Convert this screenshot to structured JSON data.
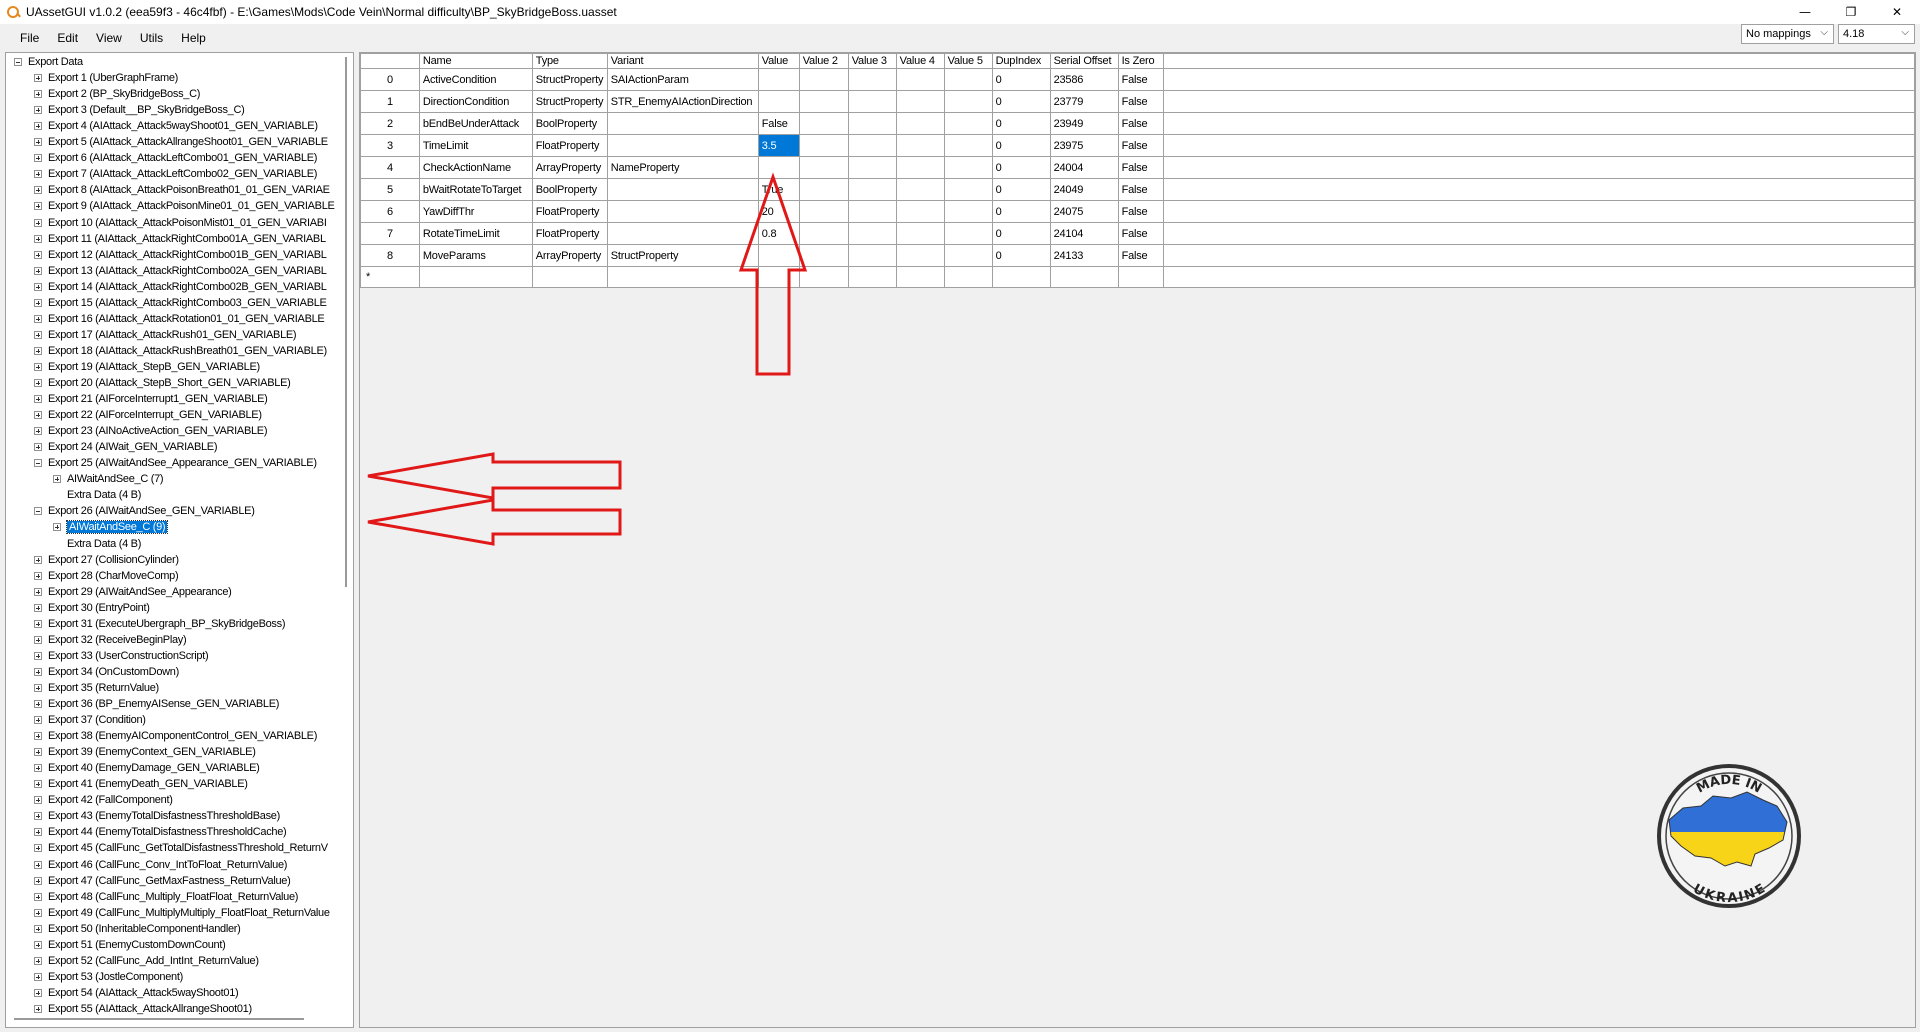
{
  "window": {
    "title": "UAssetGUI v1.0.2 (eea59f3 - 46c4fbf) - E:\\Games\\Mods\\Code Vein\\Normal difficulty\\BP_SkyBridgeBoss.uasset",
    "minimize": "—",
    "maximize": "❐",
    "close": "✕"
  },
  "menu": {
    "file": "File",
    "edit": "Edit",
    "view": "View",
    "utils": "Utils",
    "help": "Help"
  },
  "mappings_dropdown": {
    "value": "No mappings"
  },
  "version_dropdown": {
    "value": "4.18"
  },
  "tree": {
    "root": "Export Data",
    "items": [
      "Export 1 (UberGraphFrame)",
      "Export 2 (BP_SkyBridgeBoss_C)",
      "Export 3 (Default__BP_SkyBridgeBoss_C)",
      "Export 4 (AIAttack_Attack5wayShoot01_GEN_VARIABLE)",
      "Export 5 (AIAttack_AttackAllrangeShoot01_GEN_VARIABLE",
      "Export 6 (AIAttack_AttackLeftCombo01_GEN_VARIABLE)",
      "Export 7 (AIAttack_AttackLeftCombo02_GEN_VARIABLE)",
      "Export 8 (AIAttack_AttackPoisonBreath01_01_GEN_VARIAE",
      "Export 9 (AIAttack_AttackPoisonMine01_01_GEN_VARIABLE",
      "Export 10 (AIAttack_AttackPoisonMist01_01_GEN_VARIABI",
      "Export 11 (AIAttack_AttackRightCombo01A_GEN_VARIABL",
      "Export 12 (AIAttack_AttackRightCombo01B_GEN_VARIABL",
      "Export 13 (AIAttack_AttackRightCombo02A_GEN_VARIABL",
      "Export 14 (AIAttack_AttackRightCombo02B_GEN_VARIABL",
      "Export 15 (AIAttack_AttackRightCombo03_GEN_VARIABLE",
      "Export 16 (AIAttack_AttackRotation01_01_GEN_VARIABLE",
      "Export 17 (AIAttack_AttackRush01_GEN_VARIABLE)",
      "Export 18 (AIAttack_AttackRushBreath01_GEN_VARIABLE)",
      "Export 19 (AIAttack_StepB_GEN_VARIABLE)",
      "Export 20 (AIAttack_StepB_Short_GEN_VARIABLE)",
      "Export 21 (AIForceInterrupt1_GEN_VARIABLE)",
      "Export 22 (AIForceInterrupt_GEN_VARIABLE)",
      "Export 23 (AINoActiveAction_GEN_VARIABLE)",
      "Export 24 (AIWait_GEN_VARIABLE)",
      "Export 25 (AIWaitAndSee_Appearance_GEN_VARIABLE)",
      "AIWaitAndSee_C (7)",
      "Extra Data (4 B)",
      "Export 26 (AIWaitAndSee_GEN_VARIABLE)",
      "AIWaitAndSee_C (9)",
      "Extra Data (4 B)",
      "Export 27 (CollisionCylinder)",
      "Export 28 (CharMoveComp)",
      "Export 29 (AIWaitAndSee_Appearance)",
      "Export 30 (EntryPoint)",
      "Export 31 (ExecuteUbergraph_BP_SkyBridgeBoss)",
      "Export 32 (ReceiveBeginPlay)",
      "Export 33 (UserConstructionScript)",
      "Export 34 (OnCustomDown)",
      "Export 35 (ReturnValue)",
      "Export 36 (BP_EnemyAISense_GEN_VARIABLE)",
      "Export 37 (Condition)",
      "Export 38 (EnemyAIComponentControl_GEN_VARIABLE)",
      "Export 39 (EnemyContext_GEN_VARIABLE)",
      "Export 40 (EnemyDamage_GEN_VARIABLE)",
      "Export 41 (EnemyDeath_GEN_VARIABLE)",
      "Export 42 (FallComponent)",
      "Export 43 (EnemyTotalDisfastnessThresholdBase)",
      "Export 44 (EnemyTotalDisfastnessThresholdCache)",
      "Export 45 (CallFunc_GetTotalDisfastnessThreshold_ReturnV",
      "Export 46 (CallFunc_Conv_IntToFloat_ReturnValue)",
      "Export 47 (CallFunc_GetMaxFastness_ReturnValue)",
      "Export 48 (CallFunc_Multiply_FloatFloat_ReturnValue)",
      "Export 49 (CallFunc_MultiplyMultiply_FloatFloat_ReturnValue",
      "Export 50 (InheritableComponentHandler)",
      "Export 51 (EnemyCustomDownCount)",
      "Export 52 (CallFunc_Add_IntInt_ReturnValue)",
      "Export 53 (JostleComponent)",
      "Export 54 (AIAttack_Attack5wayShoot01)",
      "Export 55 (AIAttack_AttackAllrangeShoot01)"
    ]
  },
  "grid": {
    "headers": [
      "Name",
      "Type",
      "Variant",
      "Value",
      "Value 2",
      "Value 3",
      "Value 4",
      "Value 5",
      "DupIndex",
      "Serial Offset",
      "Is Zero"
    ],
    "rows": [
      [
        "0",
        "ActiveCondition",
        "StructProperty",
        "SAIActionParam",
        "",
        "",
        "",
        "",
        "",
        "0",
        "23586",
        "False"
      ],
      [
        "1",
        "DirectionCondition",
        "StructProperty",
        "STR_EnemyAIActionDirection",
        "",
        "",
        "",
        "",
        "",
        "0",
        "23779",
        "False"
      ],
      [
        "2",
        "bEndBeUnderAttack",
        "BoolProperty",
        "",
        "False",
        "",
        "",
        "",
        "",
        "0",
        "23949",
        "False"
      ],
      [
        "3",
        "TimeLimit",
        "FloatProperty",
        "",
        "3.5",
        "",
        "",
        "",
        "",
        "0",
        "23975",
        "False"
      ],
      [
        "4",
        "CheckActionName",
        "ArrayProperty",
        "NameProperty",
        "",
        "",
        "",
        "",
        "",
        "0",
        "24004",
        "False"
      ],
      [
        "5",
        "bWaitRotateToTarget",
        "BoolProperty",
        "",
        "True",
        "",
        "",
        "",
        "",
        "0",
        "24049",
        "False"
      ],
      [
        "6",
        "YawDiffThr",
        "FloatProperty",
        "",
        "20",
        "",
        "",
        "",
        "",
        "0",
        "24075",
        "False"
      ],
      [
        "7",
        "RotateTimeLimit",
        "FloatProperty",
        "",
        "0.8",
        "",
        "",
        "",
        "",
        "0",
        "24104",
        "False"
      ],
      [
        "8",
        "MoveParams",
        "ArrayProperty",
        "StructProperty",
        "",
        "",
        "",
        "",
        "",
        "0",
        "24133",
        "False"
      ]
    ],
    "new_row_marker": "*"
  },
  "badge": {
    "text": "MADE IN UKRAINE",
    "colors": {
      "blue": "#2f6fd6",
      "yellow": "#f7d417"
    }
  },
  "annotations": {
    "arrow_color": "#e01818"
  }
}
